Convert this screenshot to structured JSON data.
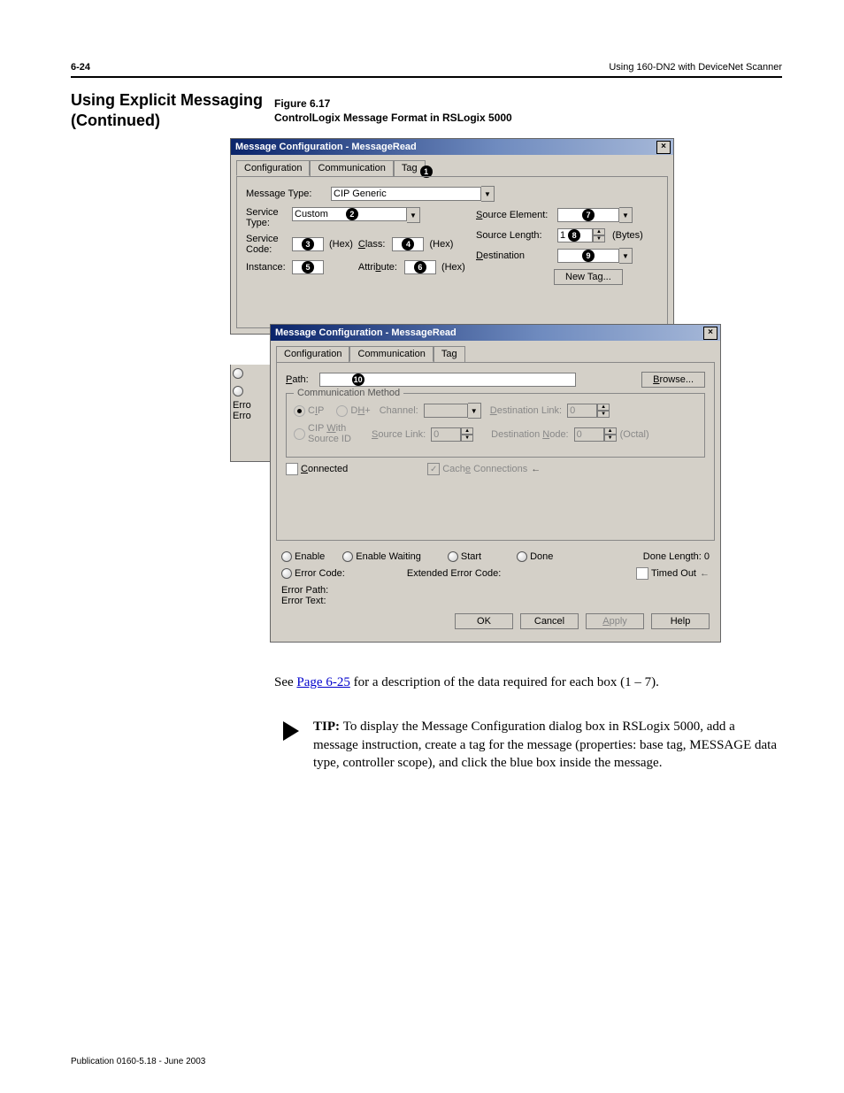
{
  "header": {
    "page_num": "6-24",
    "chapter": "Using 160-DN2 with DeviceNet Scanner"
  },
  "section_title_1": "Using Explicit Messaging",
  "section_title_2": "(Continued)",
  "figure": {
    "label": "Figure 6.17",
    "title": "ControlLogix Message Format in RSLogix 5000"
  },
  "dialog1": {
    "title": "Message Configuration - MessageRead",
    "tabs": [
      "Configuration",
      "Communication",
      "Tag"
    ],
    "message_type_lbl": "Message Type:",
    "message_type_val": "CIP Generic",
    "service_type_lbl": "Service Type:",
    "service_type_val": "Custom",
    "service_code_lbl": "Service Code:",
    "instance_lbl": "Instance:",
    "class_lbl": "Class:",
    "attribute_lbl": "Attribute:",
    "hex": "(Hex)",
    "source_element_lbl": "Source Element:",
    "source_length_lbl": "Source Length:",
    "source_length_val": "1",
    "bytes": "(Bytes)",
    "destination_lbl": "Destination",
    "new_tag_btn": "New Tag...",
    "n1": "➊",
    "n2": "➋",
    "n3": "➌",
    "n4": "➍",
    "n5": "➎",
    "n6": "➏",
    "n7": "➐",
    "n8": "➑",
    "n9": "➒",
    "n10": "➓"
  },
  "dialog2": {
    "title": "Message Configuration - MessageRead",
    "tabs": [
      "Configuration",
      "Communication",
      "Tag"
    ],
    "path_lbl": "Path:",
    "browse_btn": "Browse...",
    "group_legend": "Communication Method",
    "cip": "CIP",
    "dhp": "DH+",
    "cip_with": "CIP With Source ID",
    "channel_lbl": "Channel:",
    "source_link_lbl": "Source Link:",
    "dest_link_lbl": "Destination Link:",
    "dest_node_lbl": "Destination Node:",
    "zero": "0",
    "octal": "(Octal)",
    "connected": "Connected",
    "cache_conn": "Cache Connections",
    "enable": "Enable",
    "enable_waiting": "Enable Waiting",
    "start": "Start",
    "done": "Done",
    "done_length": "Done Length: 0",
    "error_code": "Error Code:",
    "extended_error_code": "Extended Error Code:",
    "timed_out": "Timed Out",
    "error_path": "Error Path:",
    "error_text": "Error Text:",
    "ok": "OK",
    "cancel": "Cancel",
    "apply": "Apply",
    "help": "Help"
  },
  "peek": {
    "err1": "Erro",
    "err2": "Erro"
  },
  "see_text_1": "See ",
  "see_link": "Page 6-25",
  "see_text_2": " for a description of the data required for each box (1 – 7).",
  "tip_bold": "TIP:  ",
  "tip_body": "To display the Message Configuration dialog box in RSLogix 5000, add a message instruction, create a tag for the message (properties: base tag, MESSAGE data type, controller scope), and click the blue box inside the message.",
  "publication": "Publication 0160-5.18 - June 2003"
}
